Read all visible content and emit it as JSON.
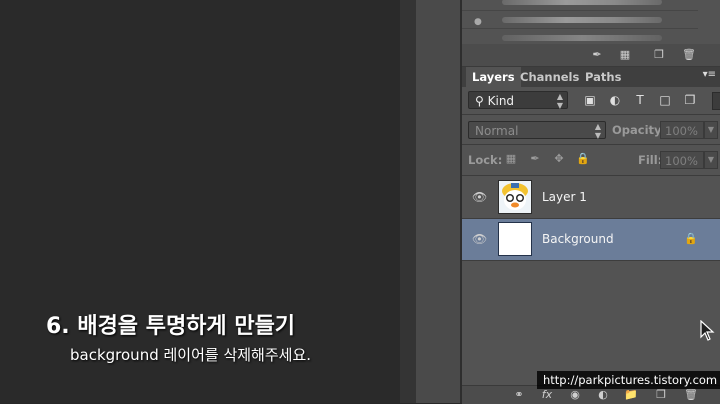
{
  "brushes_panel": {
    "bottom_icons": [
      "brush-tool-icon",
      "grid-icon",
      "new-preset-icon",
      "trash-icon"
    ]
  },
  "tabs": [
    {
      "label": "Layers",
      "active": true
    },
    {
      "label": "Channels",
      "active": false
    },
    {
      "label": "Paths",
      "active": false
    }
  ],
  "filter": {
    "kind_label": "Kind",
    "icons": [
      "image-filter-icon",
      "adjustment-filter-icon",
      "type-filter-icon",
      "shape-filter-icon",
      "smart-object-filter-icon"
    ]
  },
  "blend": {
    "mode": "Normal",
    "opacity_label": "Opacity:",
    "opacity_value": "100%"
  },
  "lock": {
    "label": "Lock:",
    "fill_label": "Fill:",
    "fill_value": "100%"
  },
  "layers": [
    {
      "name": "Layer 1",
      "selected": false,
      "locked": false
    },
    {
      "name": "Background",
      "selected": true,
      "locked": true
    }
  ],
  "footer_icons": [
    "link-icon",
    "fx-icon",
    "mask-icon",
    "adjustment-icon",
    "folder-icon",
    "new-layer-icon",
    "trash-icon"
  ],
  "caption": {
    "title": "6. 배경을 투명하게 만들기",
    "subtitle": "background 레이어를 삭제해주세요."
  },
  "watermark": "http://parkpictures.tistory.com",
  "colors": {
    "panel": "#535353",
    "selected_layer": "#6b7d99",
    "canvas": "#2a2a2a"
  }
}
